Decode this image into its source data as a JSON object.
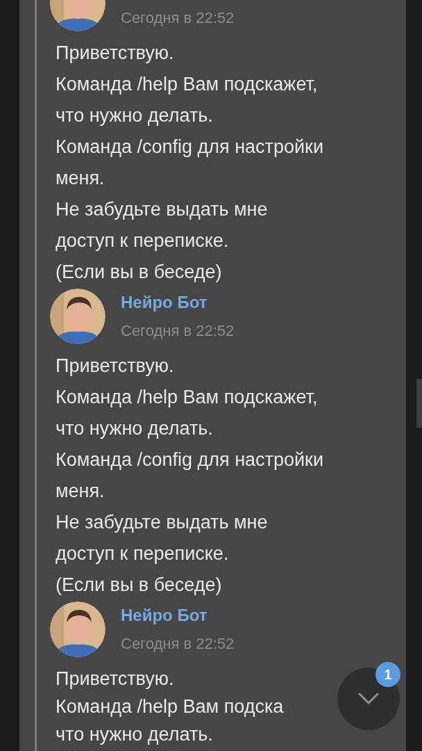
{
  "messages": [
    {
      "time": "Сегодня в 22:52",
      "lines": [
        "Приветствую.",
        "Команда /help Вам подскажет,",
        "что нужно делать.",
        "Команда /config для настройки",
        "меня.",
        "Не забудьте выдать мне",
        "доступ к переписке.",
        "(Если вы в беседе)"
      ]
    },
    {
      "author": "Нейро Бот",
      "time": "Сегодня в 22:52",
      "lines": [
        "Приветствую.",
        "Команда /help Вам подскажет,",
        "что нужно делать.",
        "Команда /config для настройки",
        "меня.",
        "Не забудьте выдать мне",
        "доступ к переписке.",
        "(Если вы в беседе)"
      ]
    },
    {
      "author": "Нейро Бот",
      "time": "Сегодня в 22:52",
      "lines": [
        "Приветствую.",
        "Команда /help Вам подска",
        "что нужно делать."
      ]
    }
  ],
  "scroll_button": {
    "badge": "1"
  }
}
